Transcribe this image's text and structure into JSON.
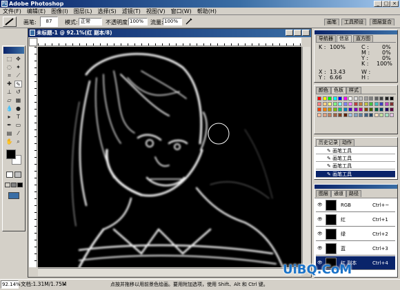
{
  "window": {
    "title": "Adobe Photoshop",
    "logo_glyph": "Ps",
    "min": "_",
    "max": "□",
    "close": "×"
  },
  "menu": [
    "文件(F)",
    "编辑(E)",
    "图像(I)",
    "图层(L)",
    "选择(S)",
    "滤镜(T)",
    "视图(V)",
    "窗口(W)",
    "帮助(H)"
  ],
  "options": {
    "brush_label": "画笔:",
    "brush_size": "87",
    "mode_label": "模式:",
    "mode_value": "正常",
    "opacity_label": "不透明度:",
    "opacity_value": "100%",
    "flow_label": "流量:",
    "flow_value": "100%",
    "palette_tabs": [
      "画笔",
      "工具预设",
      "图层复合"
    ]
  },
  "document": {
    "title": "未标题-1 @ 92.1%(红 副本/8)"
  },
  "navigator_panel": {
    "tabs": [
      "导航器",
      "信息",
      "直方图"
    ],
    "k_label": "K :",
    "k_value": "100%",
    "c_label": "C :",
    "m_label": "M :",
    "y_label": "Y :",
    "k2_label": "K :",
    "c_value": "0%",
    "m_value": "0%",
    "y_value": "0%",
    "k2_value": "100%",
    "x_label": "X :",
    "x_value": "13.43",
    "y_coord_label": "Y :",
    "y_coord_value": "6.66",
    "w_label": "W :",
    "h_label": "H :"
  },
  "color_panel": {
    "tabs": [
      "颜色",
      "色板",
      "样式"
    ],
    "swatch_colors": [
      "#ff0000",
      "#ffff00",
      "#00ff00",
      "#00ffff",
      "#0000ff",
      "#ff00ff",
      "#ffffff",
      "#e0e0e0",
      "#c0c0c0",
      "#a0a0a0",
      "#808080",
      "#606060",
      "#404040",
      "#202020",
      "#000000",
      "#ff8080",
      "#ffd080",
      "#ffff80",
      "#80ff80",
      "#80ffff",
      "#8080ff",
      "#ff80ff",
      "#c04040",
      "#c08040",
      "#c0c040",
      "#40c040",
      "#40c0c0",
      "#4040c0",
      "#c040c0",
      "#803030",
      "#ff4000",
      "#ff8000",
      "#c0a000",
      "#80c000",
      "#00c080",
      "#0080c0",
      "#4000c0",
      "#8000c0",
      "#c00080",
      "#804000",
      "#406000",
      "#006040",
      "#004060",
      "#200060",
      "#600040",
      "#ffc0a0",
      "#e0a080",
      "#c08060",
      "#a06040",
      "#804020",
      "#602000",
      "#a0c0e0",
      "#80a0c0",
      "#6080a0",
      "#406080",
      "#204060",
      "#ffe0c0",
      "#c0e0a0",
      "#a0e0c0",
      "#e0c0e0"
    ]
  },
  "history_panel": {
    "tabs": [
      "历史记录",
      "动作"
    ],
    "items": [
      "画笔工具",
      "画笔工具",
      "画笔工具",
      "画笔工具"
    ]
  },
  "channels_panel": {
    "tabs": [
      "图层",
      "通道",
      "路径"
    ],
    "rows": [
      {
        "name": "RGB",
        "shortcut": "Ctrl+~"
      },
      {
        "name": "红",
        "shortcut": "Ctrl+1"
      },
      {
        "name": "绿",
        "shortcut": "Ctrl+2"
      },
      {
        "name": "蓝",
        "shortcut": "Ctrl+3"
      },
      {
        "name": "红 副本",
        "shortcut": "Ctrl+4"
      }
    ]
  },
  "status": {
    "zoom": "92.14%",
    "doc_size": "文档:1.31M/1.75M",
    "hint": "点按并拖移以用前景色绘画。要用附加选项，使用 Shift、Alt 和 Ctrl 键。"
  },
  "watermark": {
    "text": "UiBQ.CoM"
  }
}
